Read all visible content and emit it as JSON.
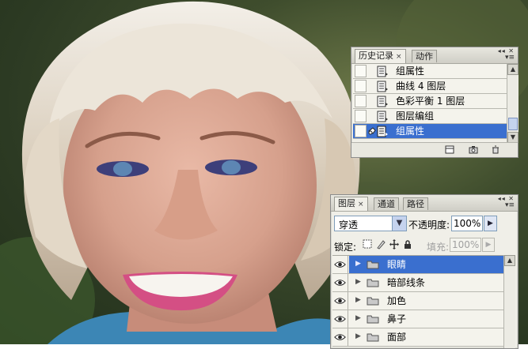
{
  "history_panel": {
    "tabs": [
      {
        "label": "历史记录",
        "close": "×"
      },
      {
        "label": "动作"
      }
    ],
    "items": [
      {
        "label": "组属性",
        "selected": false
      },
      {
        "label": "曲线 4 图层",
        "selected": false
      },
      {
        "label": "色彩平衡 1 图层",
        "selected": false
      },
      {
        "label": "图层编组",
        "selected": false
      },
      {
        "label": "组属性",
        "selected": true
      }
    ],
    "footer_icons": [
      "new-document-from-state-icon",
      "new-snapshot-icon",
      "delete-state-icon"
    ]
  },
  "layers_panel": {
    "tabs": [
      {
        "label": "图层",
        "close": "×"
      },
      {
        "label": "通道"
      },
      {
        "label": "路径"
      }
    ],
    "blend_mode": "穿透",
    "opacity_label": "不透明度:",
    "opacity_value": "100%",
    "lock_label": "锁定:",
    "fill_label": "填充:",
    "fill_value": "100%",
    "layers": [
      {
        "name": "眼睛",
        "visible": true,
        "selected": true,
        "type": "group"
      },
      {
        "name": "暗部线条",
        "visible": true,
        "selected": false,
        "type": "group"
      },
      {
        "name": "加色",
        "visible": true,
        "selected": false,
        "type": "group"
      },
      {
        "name": "鼻子",
        "visible": true,
        "selected": false,
        "type": "group"
      },
      {
        "name": "面部",
        "visible": true,
        "selected": false,
        "type": "group"
      }
    ]
  },
  "colors": {
    "selection": "#3a6fcf",
    "panel_bg": "#f0efe8"
  }
}
